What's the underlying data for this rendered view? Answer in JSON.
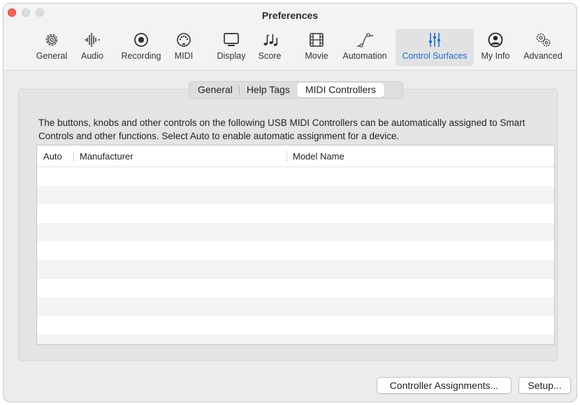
{
  "window": {
    "title": "Preferences"
  },
  "toolbar": {
    "items": [
      {
        "label": "General",
        "icon": "gear-icon"
      },
      {
        "label": "Audio",
        "icon": "waveform-icon"
      },
      {
        "label": "Recording",
        "icon": "record-icon"
      },
      {
        "label": "MIDI",
        "icon": "midi-connector-icon"
      },
      {
        "label": "Display",
        "icon": "display-icon"
      },
      {
        "label": "Score",
        "icon": "music-notes-icon"
      },
      {
        "label": "Movie",
        "icon": "film-icon"
      },
      {
        "label": "Automation",
        "icon": "automation-curve-icon"
      },
      {
        "label": "Control Surfaces",
        "icon": "sliders-icon",
        "active": true
      },
      {
        "label": "My Info",
        "icon": "person-icon"
      },
      {
        "label": "Advanced",
        "icon": "gears-icon"
      }
    ]
  },
  "tabs": {
    "general": "General",
    "help_tags": "Help Tags",
    "midi_controllers": "MIDI Controllers",
    "selected": "MIDI Controllers"
  },
  "description": "The buttons, knobs and other controls on the following USB MIDI Controllers can be automatically assigned to Smart Controls and other functions. Select Auto to enable automatic assignment for a device.",
  "table": {
    "columns": [
      "Auto",
      "Manufacturer",
      "Model Name"
    ],
    "rows": []
  },
  "buttons": {
    "controller_assignments": "Controller Assignments...",
    "setup": "Setup..."
  },
  "colors": {
    "accent": "#1a6fe0",
    "close": "#ff5f57"
  }
}
